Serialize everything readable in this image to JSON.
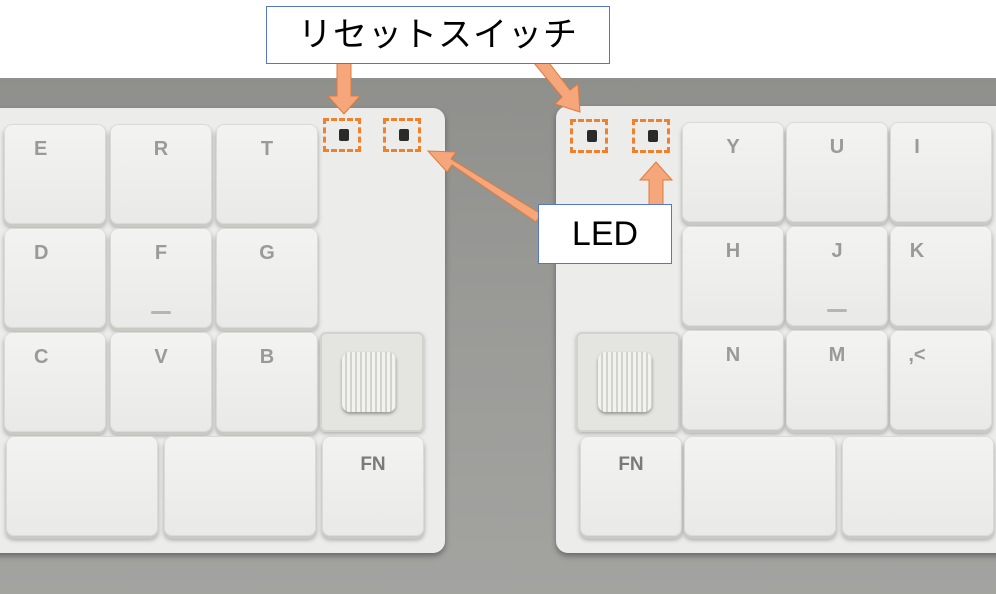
{
  "callouts": {
    "reset_switch": "リセットスイッチ",
    "led": "LED"
  },
  "left_half": {
    "keys": {
      "e": "E",
      "r": "R",
      "t": "T",
      "d": "D",
      "f": "F",
      "g": "G",
      "c": "C",
      "v": "V",
      "b": "B",
      "space1": "",
      "space2": "",
      "fn": "FN"
    }
  },
  "right_half": {
    "keys": {
      "y": "Y",
      "u": "U",
      "i": "I",
      "h": "H",
      "j": "J",
      "k": "K",
      "n": "N",
      "m": "M",
      "comma": ",<",
      "space1": "",
      "space2": "",
      "fn": "FN"
    }
  },
  "colors": {
    "annotation_accent": "#f0802c",
    "callout_border": "#5577c8",
    "keycap": "#efefed"
  }
}
